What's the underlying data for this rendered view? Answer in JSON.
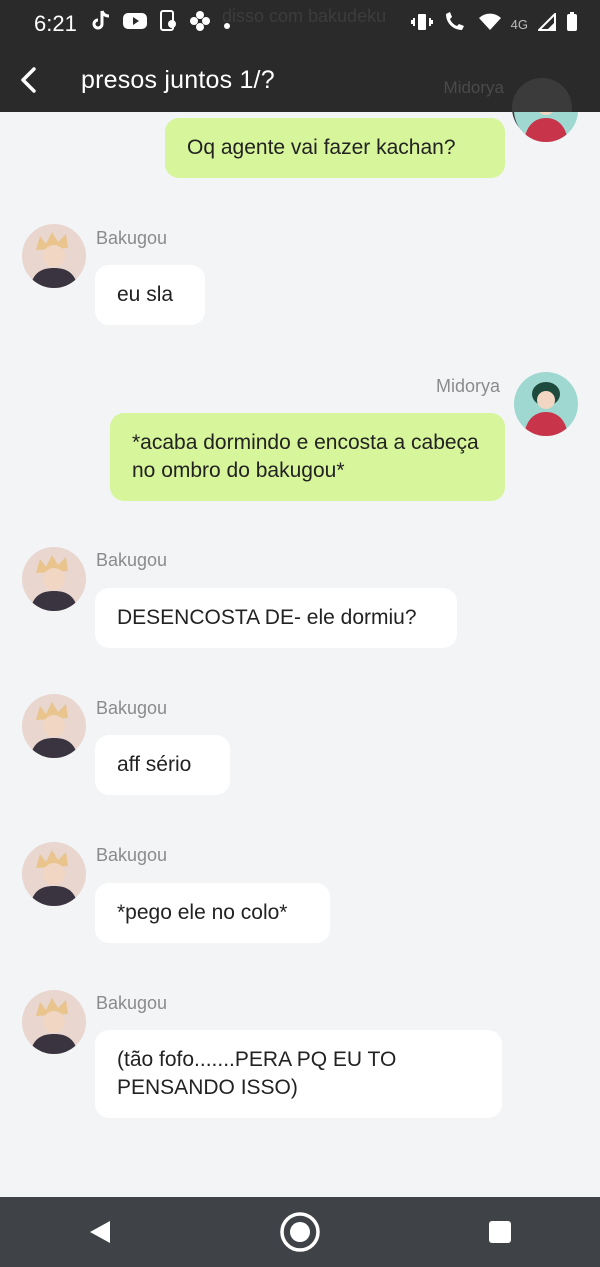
{
  "status_bar": {
    "time": "6:21",
    "ghost_text": "disso com bakudeku",
    "network_label": "4G"
  },
  "app_bar": {
    "title": "presos juntos 1/?",
    "ghost_name": "Midorya"
  },
  "characters": {
    "bakugou": {
      "name": "Bakugou",
      "avatar_colors": {
        "bg": "#e8d6cf",
        "hair": "#e9c58d",
        "shirt": "#3a3440"
      }
    },
    "midorya": {
      "name": "Midorya",
      "avatar_colors": {
        "bg": "#9fd8d0",
        "hair": "#1d4a3c",
        "shirt": "#c8344a"
      }
    }
  },
  "messages": [
    {
      "sender": "midorya",
      "side": "right",
      "show_name": false,
      "text": "Oq agente vai fazer kachan?"
    },
    {
      "sender": "bakugou",
      "side": "left",
      "show_name": true,
      "name": "Bakugou",
      "text": "eu sla"
    },
    {
      "sender": "midorya",
      "side": "right",
      "show_name": true,
      "name": "Midorya",
      "text": "*acaba dormindo e encosta a cabeça no ombro do bakugou*"
    },
    {
      "sender": "bakugou",
      "side": "left",
      "show_name": true,
      "name": "Bakugou",
      "text": "DESENCOSTA DE- ele dormiu?"
    },
    {
      "sender": "bakugou",
      "side": "left",
      "show_name": true,
      "name": "Bakugou",
      "text": "aff sério"
    },
    {
      "sender": "bakugou",
      "side": "left",
      "show_name": true,
      "name": "Bakugou",
      "text": "*pego ele no colo*"
    },
    {
      "sender": "bakugou",
      "side": "left",
      "show_name": true,
      "name": "Bakugou",
      "text": "(tão fofo.......PERA PQ EU TO PENSANDO ISSO)"
    }
  ],
  "colors": {
    "bar": "#2a2a2a",
    "chat_bg": "#f3f4f6",
    "bubble_left": "#ffffff",
    "bubble_right": "#d7f59a",
    "nav_bar": "#3f4246"
  },
  "nav": {
    "back_icon": "back-triangle-icon",
    "home_icon": "home-circle-icon",
    "recents_icon": "recents-square-icon"
  }
}
